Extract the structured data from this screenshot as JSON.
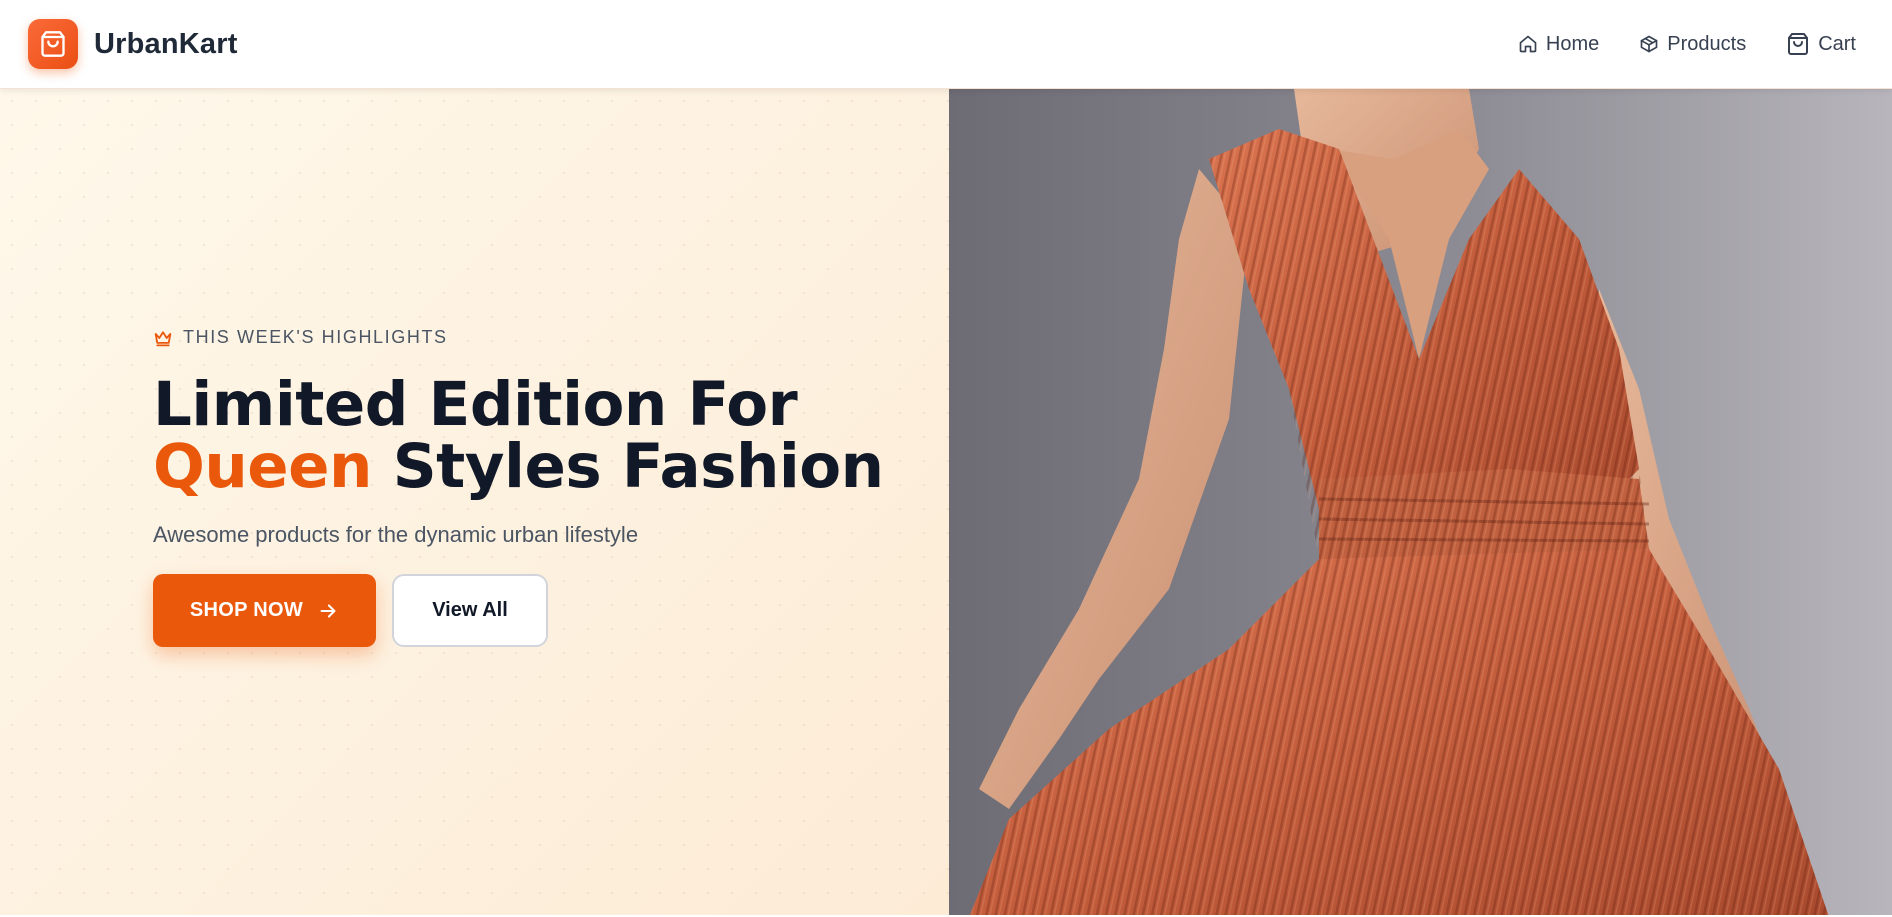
{
  "brand": {
    "name": "UrbanKart",
    "icon": "shopping-bag-icon",
    "accent": "#ea580c"
  },
  "nav": {
    "items": [
      {
        "label": "Home",
        "icon": "home-icon"
      },
      {
        "label": "Products",
        "icon": "box-icon"
      },
      {
        "label": "Cart",
        "icon": "shopping-bag-icon"
      }
    ]
  },
  "hero": {
    "eyebrow": "THIS WEEK'S HIGHLIGHTS",
    "eyebrow_icon": "crown-icon",
    "headline_line1": "Limited Edition For",
    "headline_accent": "Queen",
    "headline_rest": " Styles Fashion",
    "subtitle": "Awesome products for the dynamic urban lifestyle",
    "primary_cta": "SHOP NOW",
    "secondary_cta": "View All",
    "image": "model-orange-pleated-dress"
  },
  "colors": {
    "primary": "#ea580c",
    "hero_bg": "#fff8ea",
    "text_dark": "#111827"
  }
}
